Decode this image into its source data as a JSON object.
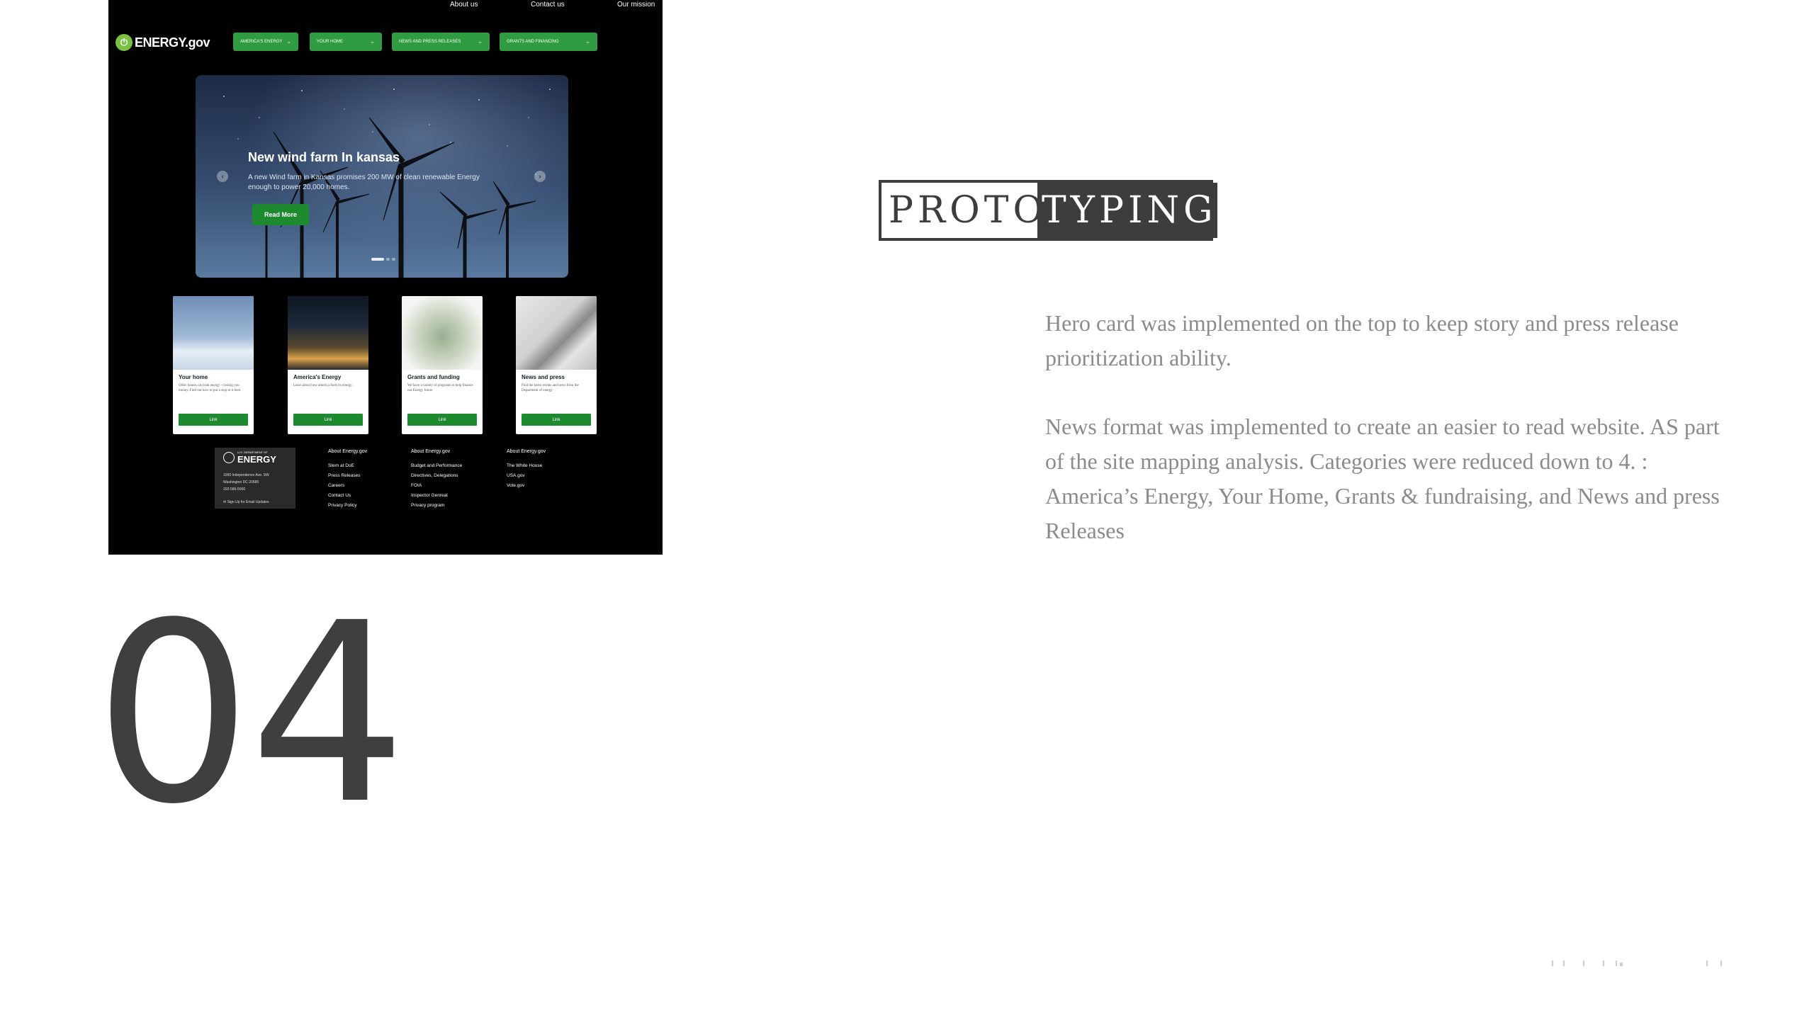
{
  "prototype": {
    "top_nav": [
      "About us",
      "Contact us",
      "Our mission"
    ],
    "logo_text": "ENERGY.gov",
    "nav_buttons": [
      "AMERICA'S ENERGY",
      "YOUR HOME",
      "NEWS AND PRESS RELEASES",
      "GRANTS AND FINANCING"
    ],
    "hero": {
      "title": "New wind farm In kansas",
      "text": "A new Wind farm in Kansas promises 200 MW of clean renewable Energy enough to power 20,000 homes.",
      "button": "Read More"
    },
    "cards": [
      {
        "title": "Your home",
        "desc": "Older homes can leak energy - costing you money. Find out how to put a stop to it here.",
        "button": "Link"
      },
      {
        "title": "America's Energy",
        "desc": "Learn about how america fuels its energy.",
        "button": "Link"
      },
      {
        "title": "Grants and funding",
        "desc": "We have a variety of programs to help finance our Energy future",
        "button": "Link"
      },
      {
        "title": "News and press",
        "desc": "Find the latest events and news from the Department of energy",
        "button": "Link"
      }
    ],
    "footer": {
      "dept": "U.S. DEPARTMENT OF",
      "brand": "ENERGY",
      "address": [
        "1000 Independence Ave. SW",
        "Washington DC 20585",
        "202-586-5000"
      ],
      "signup": "Sign Up for Email Updates",
      "columns": [
        {
          "heading": "About Energy.gov",
          "links": [
            "Stem at DoE",
            "Press Releases",
            "Careers",
            "Contact Us",
            "Privacy Policy"
          ]
        },
        {
          "heading": "About Energy.gov",
          "links": [
            "Budget and Performance",
            "Directives, Delegations",
            "FOIA",
            "Inspector Genreal",
            "Privacy program"
          ]
        },
        {
          "heading": "About Energy.gov",
          "links": [
            "The White House",
            "USA.gov",
            "Vote.gov"
          ]
        }
      ]
    }
  },
  "heading": {
    "part1": "PROTO",
    "part2": "TYPING"
  },
  "paragraphs": {
    "p1": "Hero card was implemented on the top to keep story and press release prioritization ability.",
    "p2": "News format was implemented to create an easier to read website. AS part of the site mapping analysis.  Categories were reduced down to 4.  : America’s  Energy, Your Home, Grants & fundraising, and News and press Releases"
  },
  "section_number": "04",
  "colors": {
    "brand_green": "#2f9c41",
    "dark_gray": "#3d3d3d",
    "text_gray": "#8b8b8b"
  }
}
